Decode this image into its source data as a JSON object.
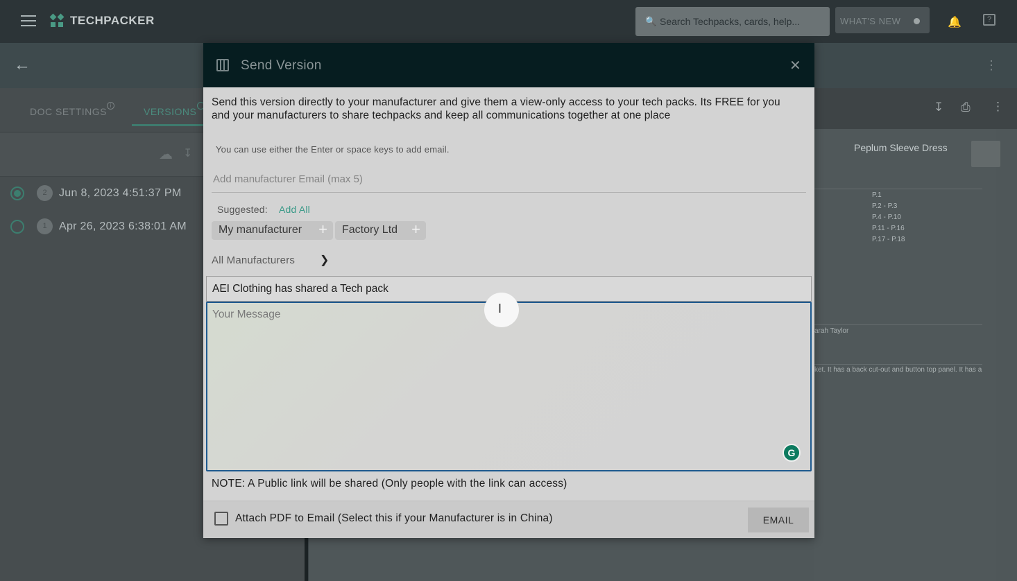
{
  "app": {
    "name": "TECHPACKER",
    "search_placeholder": "Search Techpacks, cards, help...",
    "whats_new": "WHAT'S NEW"
  },
  "left_panel": {
    "tabs": [
      {
        "label": "DOC SETTINGS"
      },
      {
        "label": "VERSIONS"
      }
    ],
    "versions": [
      {
        "number": "2",
        "date": "Jun 8, 2023 4:51:37 PM",
        "selected": true
      },
      {
        "number": "1",
        "date": "Apr 26, 2023 6:38:01 AM",
        "selected": false
      }
    ]
  },
  "document": {
    "title": "Peplum Sleeve Dress",
    "pages": [
      "P.1",
      "P.2 - P.3",
      "P.4 - P.10",
      "P.11 - P.16",
      "P.17 - P.18"
    ],
    "author_fragment": "arah Taylor",
    "description_fragment": "ket. It has a back cut-out and button top panel. It has a"
  },
  "modal": {
    "title": "Send Version",
    "description": "Send this version directly to your manufacturer and give them a view-only access to your tech packs. Its FREE for you and your manufacturers to share techpacks and keep all communications together at one place",
    "hint": "You can use either the Enter or space keys to add email.",
    "email_placeholder": "Add manufacturer Email (max 5)",
    "suggested_label": "Suggested:",
    "add_all": "Add All",
    "chips": [
      {
        "label": "My manufacturer"
      },
      {
        "label": "Factory Ltd"
      }
    ],
    "all_manufacturers": "All Manufacturers",
    "subject": "AEI Clothing has shared a Tech pack",
    "message_placeholder": "Your Message",
    "note": "NOTE: A Public link will be shared (Only people with the link can access)",
    "attach_label": "Attach PDF to Email (Select this if your Manufacturer is in China)",
    "email_button": "EMAIL"
  },
  "colors": {
    "accent": "#3b9a88",
    "modal_header": "#061d20",
    "focus_border": "#1e5a8f"
  }
}
